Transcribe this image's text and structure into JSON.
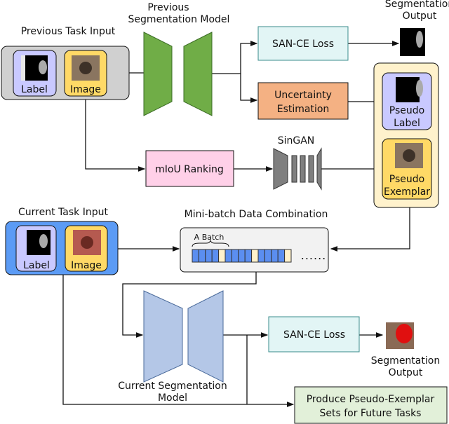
{
  "prev_input": {
    "title": "Previous Task Input",
    "label": "Label",
    "image": "Image"
  },
  "prev_model": {
    "line1": "Previous",
    "line2": "Segmentation Model"
  },
  "san_ce_1": "SAN-CE Loss",
  "uncertainty": {
    "line1": "Uncertainty",
    "line2": "Estimation"
  },
  "seg_out_1": {
    "line1": "Segmentation",
    "line2": "Output"
  },
  "pseudo_label": {
    "line1": "Pseudo",
    "line2": "Label"
  },
  "pseudo_exemplar": {
    "line1": "Pseudo",
    "line2": "Exemplar"
  },
  "miou": "mIoU Ranking",
  "singan": "SinGAN",
  "cur_input": {
    "title": "Current Task Input",
    "label": "Label",
    "image": "Image"
  },
  "minibatch": {
    "title": "Mini-batch Data Combination",
    "batch": "A Batch",
    "dots": "......"
  },
  "cur_model": {
    "line1": "Current Segmentation",
    "line2": "Model"
  },
  "san_ce_2": "SAN-CE Loss",
  "seg_out_2": {
    "line1": "Segmentation",
    "line2": "Output"
  },
  "produce": {
    "line1": "Produce Pseudo-Exemplar",
    "line2": "Sets for Future Tasks"
  },
  "colors": {
    "prev_model": "#70ad47",
    "cur_model": "#b4c7e7",
    "label_card": "#c9c9ff",
    "image_card": "#ffd966",
    "current_box": "#5b9bf5",
    "batch_blue": "#5b8ef0",
    "batch_yellow": "#fff2cc"
  }
}
